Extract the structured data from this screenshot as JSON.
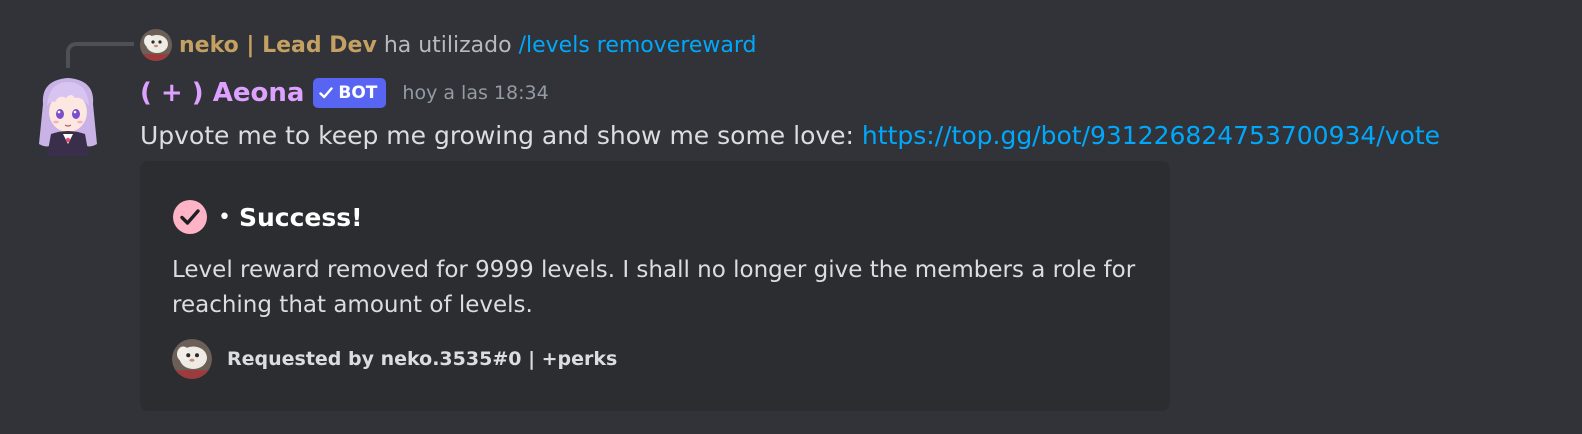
{
  "reply": {
    "author": "neko | Lead Dev",
    "action": "ha utilizado",
    "command": "/levels removereward"
  },
  "message": {
    "author": "( + ) Aeona",
    "bot_tag": "BOT",
    "timestamp": "hoy a las 18:34",
    "text": "Upvote me to keep me growing and show me some love: ",
    "link": "https://top.gg/bot/931226824753700934/vote"
  },
  "embed": {
    "title_separator": "•",
    "title": "Success!",
    "description": "Level reward removed for 9999 levels. I shall no longer give the members a role for reaching that amount of levels.",
    "footer": "Requested by neko.3535#0 | +perks"
  },
  "icons": {
    "success": "check-circle-icon",
    "bot_verified": "checkmark-icon"
  },
  "colors": {
    "background": "#313338",
    "embed_background": "#2b2d31",
    "reply_author": "#c5a063",
    "bot_author": "#dea1ff",
    "link": "#00a8fc",
    "bot_tag": "#5865f2",
    "success_icon": "#ffb3c6"
  }
}
